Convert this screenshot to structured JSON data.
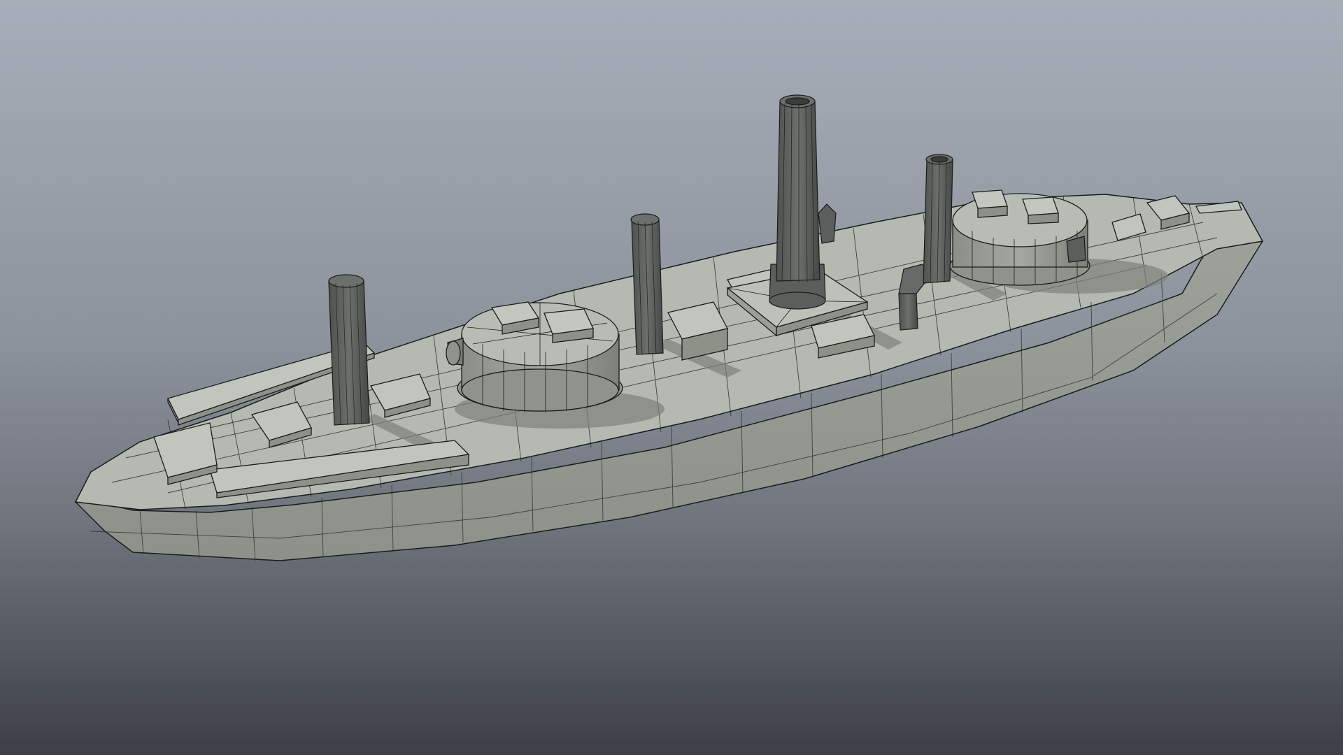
{
  "viewport": {
    "background_top": "#a8aeb9",
    "background_bottom": "#3c3f45"
  },
  "model": {
    "subject": "ironclad-warship-wireframe",
    "hull_color": "#a6aca3",
    "deck_color": "#b4bab1",
    "dark_color": "#5f635f",
    "wire_color": "#1a1c1a",
    "shadow_color": "#7d827b"
  }
}
